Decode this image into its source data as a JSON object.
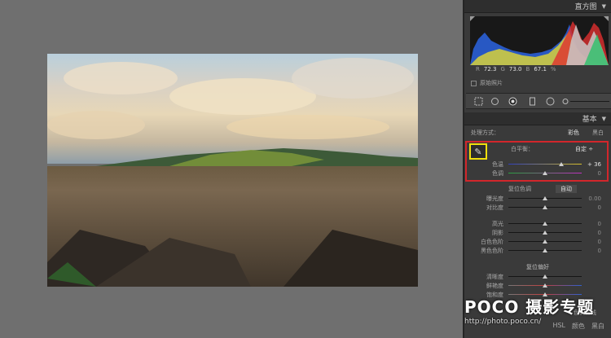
{
  "panel": {
    "histogram_title": "直方图",
    "rgb": {
      "r_label": "R",
      "r": "72.3",
      "g_label": "G",
      "g": "73.0",
      "b_label": "B",
      "b": "67.1",
      "unit": "%"
    },
    "original_photo_label": "原始照片",
    "basic_title": "基本",
    "treatment_label": "处理方式：",
    "treatment_color": "彩色",
    "treatment_bw": "黑白",
    "wb_label": "白平衡：",
    "wb_value": "自定 ÷",
    "temp_label": "色温",
    "temp_value": "+ 36",
    "tint_label": "色调",
    "tint_value": "0",
    "tone_section": "复位色调",
    "auto_label": "自动",
    "exposure_label": "曝光度",
    "exposure_value": "0.00",
    "contrast_label": "对比度",
    "contrast_value": "0",
    "highlights_label": "高光",
    "highlights_value": "0",
    "shadows_label": "阴影",
    "shadows_value": "0",
    "whites_label": "白色色阶",
    "whites_value": "0",
    "blacks_label": "黑色色阶",
    "blacks_value": "0",
    "presence_section": "复位偏好",
    "clarity_label": "清晰度",
    "vibrance_label": "鲜艳度",
    "saturation_label": "饱和度",
    "tone_curve_tab": "色调曲线",
    "tab_hsl": "HSL",
    "tab_color": "颜色",
    "tab_bw": "黑白"
  },
  "watermark": {
    "title": "POCO 摄影专题",
    "url": "http://photo.poco.cn/"
  },
  "colors": {
    "accent_red": "#d2262b",
    "accent_yellow": "#f1df0d"
  },
  "sliders": {
    "temp": 0.72,
    "tint": 0.5,
    "exposure": 0.5,
    "contrast": 0.5,
    "highlights": 0.5,
    "shadows": 0.5,
    "whites": 0.5,
    "blacks": 0.5,
    "clarity": 0.5,
    "vibrance": 0.5,
    "saturation": 0.5
  }
}
